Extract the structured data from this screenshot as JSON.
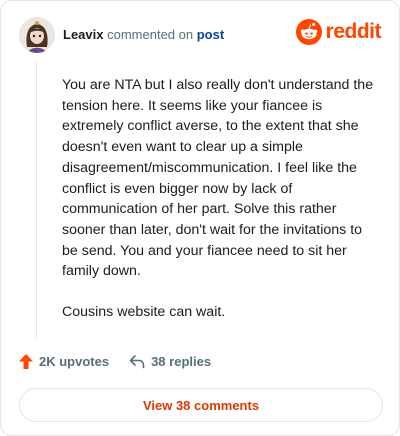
{
  "header": {
    "username": "Leavix",
    "action_text": "commented on",
    "post_link": "post",
    "brand": "reddit"
  },
  "comment": {
    "paragraphs": [
      "You are NTA but I also really don't understand the tension here. It seems like your fiancee is extremely conflict averse, to the extent that she doesn't even want to clear up a simple disagreement/miscommunication. I feel like the conflict is even bigger now by lack of communication of her part. Solve this rather sooner than later, don't wait for the invitations to be send. You and your fiancee need to sit her family down.",
      "Cousins website can wait."
    ]
  },
  "actions": {
    "upvotes": "2K upvotes",
    "replies": "38 replies"
  },
  "view_comments_label": "View 38 comments",
  "colors": {
    "brand": "#ff4500",
    "upvote": "#ff4500",
    "link": "#0a449b",
    "button_text": "#d93a00"
  },
  "icons": {
    "brand": "reddit-logo-icon",
    "upvote": "upvote-arrow-icon",
    "reply": "reply-arrow-icon"
  }
}
